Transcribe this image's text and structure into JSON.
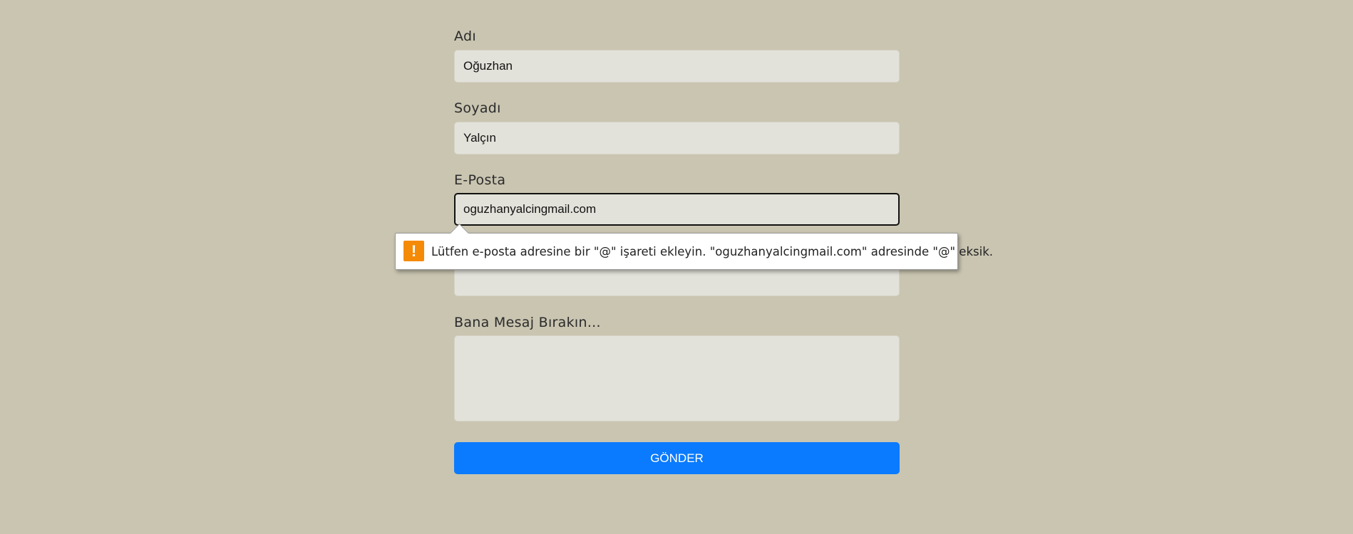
{
  "form": {
    "first_name": {
      "label": "Adı",
      "value": "Oğuzhan"
    },
    "last_name": {
      "label": "Soyadı",
      "value": "Yalçın"
    },
    "email": {
      "label": "E-Posta",
      "value": "oguzhanyalcingmail.com"
    },
    "fourth_field": {
      "value": ""
    },
    "message": {
      "label": "Bana Mesaj Bırakın...",
      "value": ""
    },
    "submit_label": "GÖNDER"
  },
  "validation_tooltip": {
    "icon": "warning-icon",
    "icon_glyph": "!",
    "icon_color": "#f58a07",
    "message": "Lütfen e-posta adresine bir \"@\" işareti ekleyin. \"oguzhanyalcingmail.com\" adresinde \"@\" eksik."
  },
  "colors": {
    "background": "#c9c5b1",
    "field_background": "#e3e2da",
    "button": "#0a7bff"
  }
}
